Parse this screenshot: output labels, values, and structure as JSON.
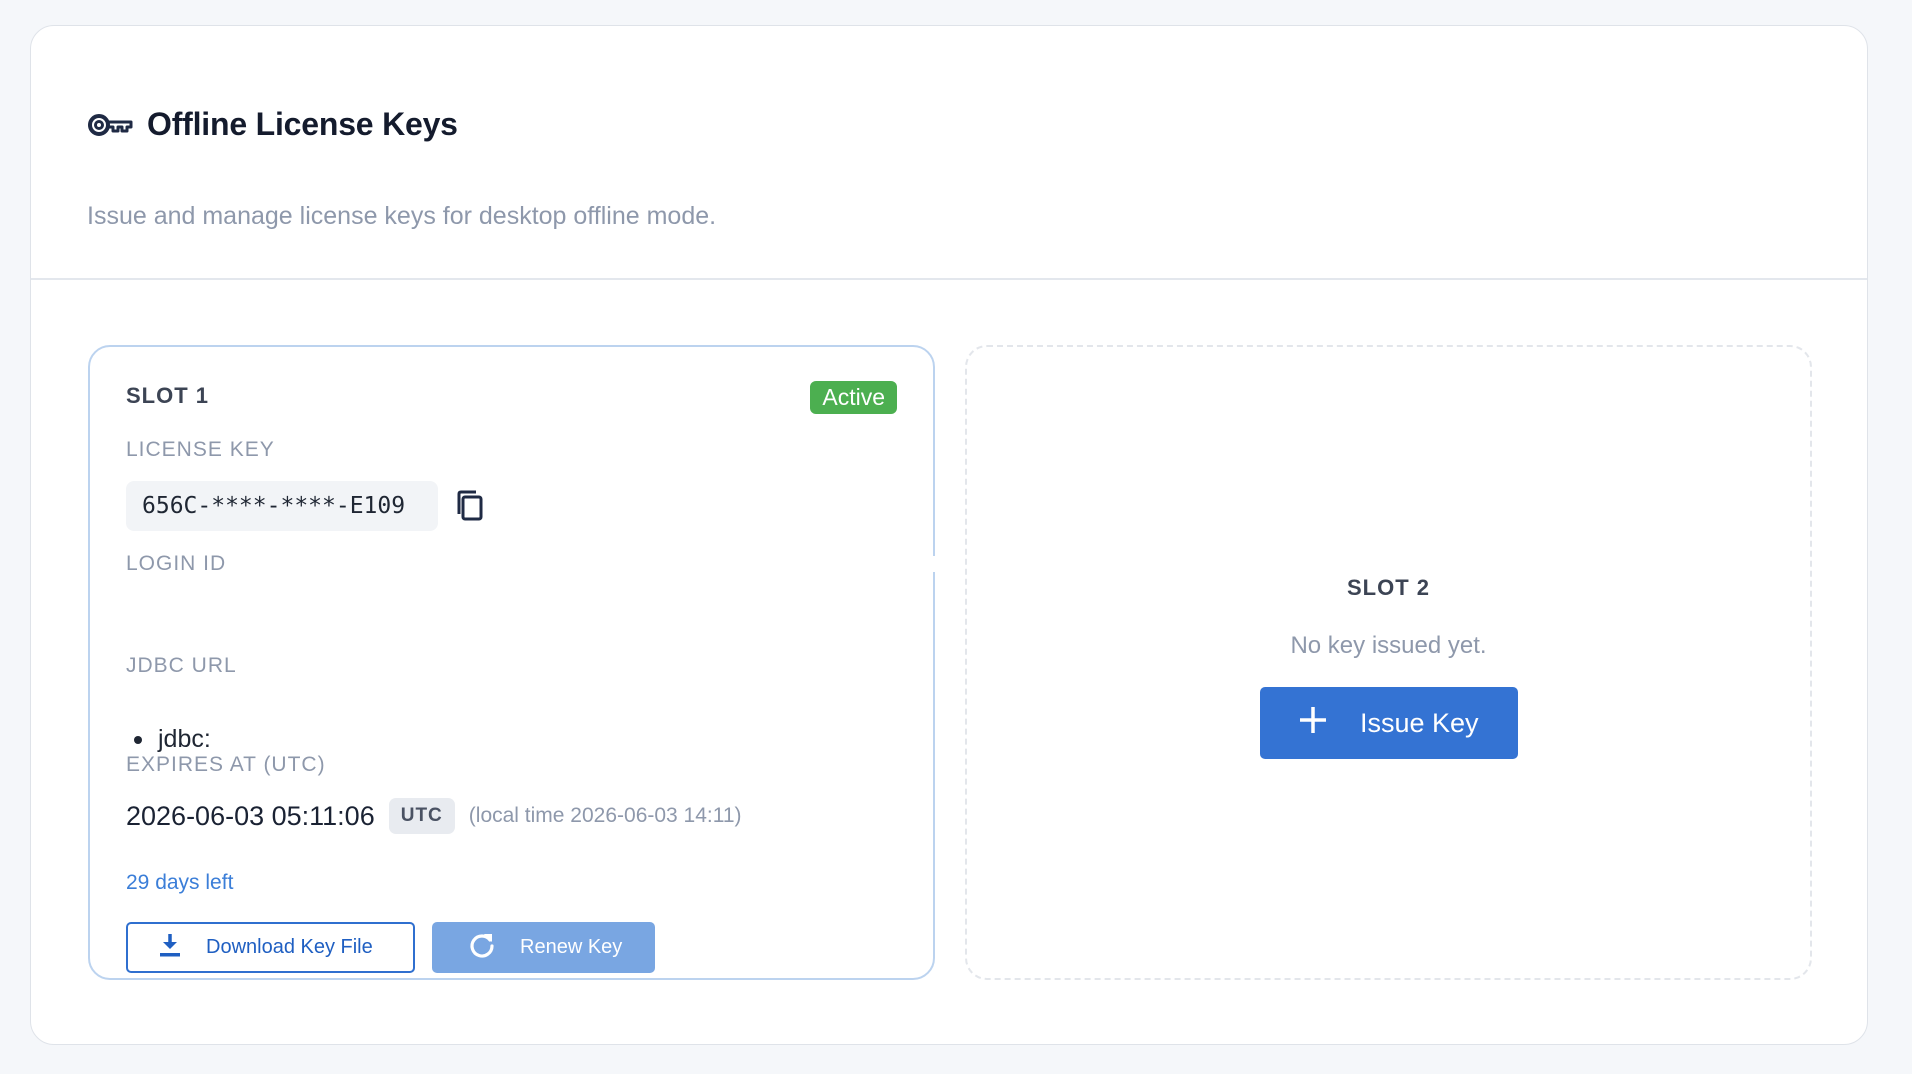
{
  "header": {
    "title": "Offline License Keys",
    "subtitle": "Issue and manage license keys for desktop offline mode.",
    "icon": "key-icon"
  },
  "slot1": {
    "title": "SLOT 1",
    "status": "Active",
    "status_color": "#4caf50",
    "license_key_label": "LICENSE KEY",
    "license_key": "656C-****-****-E109",
    "login_id_label": "LOGIN ID",
    "login_id": "",
    "jdbc_url_label": "JDBC URL",
    "jdbc_urls": [
      "jdbc:"
    ],
    "expires_label": "EXPIRES AT (UTC)",
    "expires_at": "2026-06-03 05:11:06",
    "tz_badge": "UTC",
    "local_time": "(local time 2026-06-03 14:11)",
    "days_left": "29 days left",
    "download_label": "Download Key File",
    "renew_label": "Renew Key"
  },
  "slot2": {
    "title": "SLOT 2",
    "empty_text": "No key issued yet.",
    "issue_label": "Issue Key"
  },
  "colors": {
    "primary": "#3473d3",
    "renew": "#79a6e2",
    "active": "#4caf50",
    "muted": "#8e98ab"
  }
}
